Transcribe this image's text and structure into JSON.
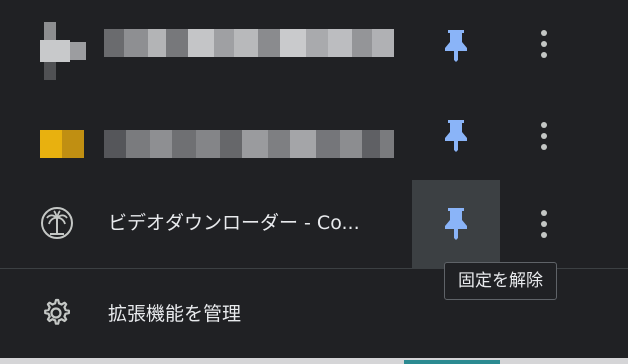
{
  "extensions": [
    {
      "name": "",
      "blurred": true,
      "icon": "blurred-extension-icon",
      "pinned": true
    },
    {
      "name": "",
      "blurred": true,
      "icon": "blurred-extension-icon",
      "pinned": true
    },
    {
      "name": "ビデオダウンローダー - Co...",
      "blurred": false,
      "icon": "palm-tree-icon",
      "pinned": true
    }
  ],
  "pin_tooltip": "固定を解除",
  "manage": {
    "label": "拡張機能を管理",
    "icon": "gear-icon"
  },
  "colors": {
    "background": "#202124",
    "pin": "#8ab4f8",
    "text": "#e8eaed",
    "hover": "#3c4043"
  }
}
